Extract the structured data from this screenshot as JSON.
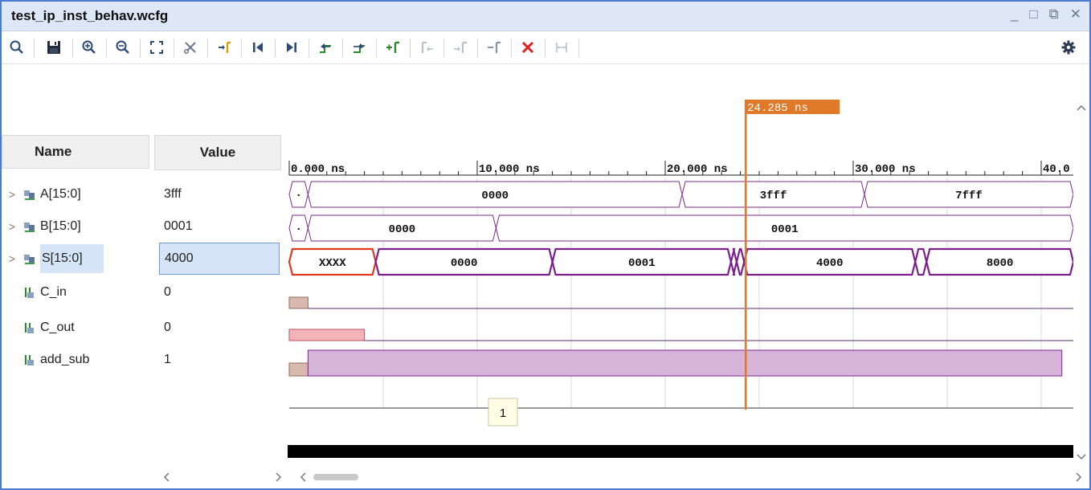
{
  "window": {
    "title": "test_ip_inst_behav.wcfg",
    "controls": [
      "_",
      "□",
      "⧉",
      "✕"
    ]
  },
  "toolbar": {
    "icons": [
      "search",
      "save",
      "zoom-in",
      "zoom-out",
      "zoom-fit",
      "cut-marker",
      "go-to-cursor",
      "go-to-start",
      "go-to-end",
      "previous-transition",
      "next-transition",
      "add-marker",
      "previous-marker",
      "next-marker",
      "remove-marker",
      "delete-all",
      "swap-cursors",
      "settings"
    ]
  },
  "columns": {
    "name": "Name",
    "value": "Value"
  },
  "signals": [
    {
      "name": "A[15:0]",
      "value": "3fff",
      "bus": true
    },
    {
      "name": "B[15:0]",
      "value": "0001",
      "bus": true
    },
    {
      "name": "S[15:0]",
      "value": "4000",
      "bus": true,
      "selected": true
    },
    {
      "name": "C_in",
      "value": "0",
      "bus": false
    },
    {
      "name": "C_out",
      "value": "0",
      "bus": false
    },
    {
      "name": "add_sub",
      "value": "1",
      "bus": false
    }
  ],
  "timeline": {
    "ticks": [
      "0.000 ns",
      "10.000 ns",
      "20.000 ns",
      "30.000 ns",
      "40.0"
    ],
    "cursor_label": "24.285 ns",
    "tooltip": "1"
  },
  "waves": {
    "A": [
      "·",
      "0000",
      "3fff",
      "7fff"
    ],
    "B": [
      "·",
      "0000",
      "0001"
    ],
    "S": [
      "XXXX",
      "0000",
      "0001",
      "4000",
      "8000"
    ]
  },
  "colors": {
    "bus": "#7b2a8e",
    "s_bus": "#7b1f8e",
    "undefined": "#e03a1e",
    "cursor": "#e07a2a",
    "accent": "#4a7bd0"
  }
}
